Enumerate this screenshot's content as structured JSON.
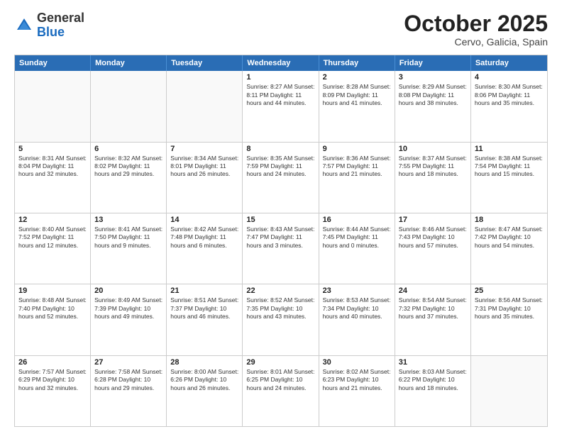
{
  "logo": {
    "general": "General",
    "blue": "Blue"
  },
  "header": {
    "month": "October 2025",
    "location": "Cervo, Galicia, Spain"
  },
  "days": [
    "Sunday",
    "Monday",
    "Tuesday",
    "Wednesday",
    "Thursday",
    "Friday",
    "Saturday"
  ],
  "weeks": [
    [
      {
        "day": "",
        "content": ""
      },
      {
        "day": "",
        "content": ""
      },
      {
        "day": "",
        "content": ""
      },
      {
        "day": "1",
        "content": "Sunrise: 8:27 AM\nSunset: 8:11 PM\nDaylight: 11 hours and 44 minutes."
      },
      {
        "day": "2",
        "content": "Sunrise: 8:28 AM\nSunset: 8:09 PM\nDaylight: 11 hours and 41 minutes."
      },
      {
        "day": "3",
        "content": "Sunrise: 8:29 AM\nSunset: 8:08 PM\nDaylight: 11 hours and 38 minutes."
      },
      {
        "day": "4",
        "content": "Sunrise: 8:30 AM\nSunset: 8:06 PM\nDaylight: 11 hours and 35 minutes."
      }
    ],
    [
      {
        "day": "5",
        "content": "Sunrise: 8:31 AM\nSunset: 8:04 PM\nDaylight: 11 hours and 32 minutes."
      },
      {
        "day": "6",
        "content": "Sunrise: 8:32 AM\nSunset: 8:02 PM\nDaylight: 11 hours and 29 minutes."
      },
      {
        "day": "7",
        "content": "Sunrise: 8:34 AM\nSunset: 8:01 PM\nDaylight: 11 hours and 26 minutes."
      },
      {
        "day": "8",
        "content": "Sunrise: 8:35 AM\nSunset: 7:59 PM\nDaylight: 11 hours and 24 minutes."
      },
      {
        "day": "9",
        "content": "Sunrise: 8:36 AM\nSunset: 7:57 PM\nDaylight: 11 hours and 21 minutes."
      },
      {
        "day": "10",
        "content": "Sunrise: 8:37 AM\nSunset: 7:55 PM\nDaylight: 11 hours and 18 minutes."
      },
      {
        "day": "11",
        "content": "Sunrise: 8:38 AM\nSunset: 7:54 PM\nDaylight: 11 hours and 15 minutes."
      }
    ],
    [
      {
        "day": "12",
        "content": "Sunrise: 8:40 AM\nSunset: 7:52 PM\nDaylight: 11 hours and 12 minutes."
      },
      {
        "day": "13",
        "content": "Sunrise: 8:41 AM\nSunset: 7:50 PM\nDaylight: 11 hours and 9 minutes."
      },
      {
        "day": "14",
        "content": "Sunrise: 8:42 AM\nSunset: 7:48 PM\nDaylight: 11 hours and 6 minutes."
      },
      {
        "day": "15",
        "content": "Sunrise: 8:43 AM\nSunset: 7:47 PM\nDaylight: 11 hours and 3 minutes."
      },
      {
        "day": "16",
        "content": "Sunrise: 8:44 AM\nSunset: 7:45 PM\nDaylight: 11 hours and 0 minutes."
      },
      {
        "day": "17",
        "content": "Sunrise: 8:46 AM\nSunset: 7:43 PM\nDaylight: 10 hours and 57 minutes."
      },
      {
        "day": "18",
        "content": "Sunrise: 8:47 AM\nSunset: 7:42 PM\nDaylight: 10 hours and 54 minutes."
      }
    ],
    [
      {
        "day": "19",
        "content": "Sunrise: 8:48 AM\nSunset: 7:40 PM\nDaylight: 10 hours and 52 minutes."
      },
      {
        "day": "20",
        "content": "Sunrise: 8:49 AM\nSunset: 7:39 PM\nDaylight: 10 hours and 49 minutes."
      },
      {
        "day": "21",
        "content": "Sunrise: 8:51 AM\nSunset: 7:37 PM\nDaylight: 10 hours and 46 minutes."
      },
      {
        "day": "22",
        "content": "Sunrise: 8:52 AM\nSunset: 7:35 PM\nDaylight: 10 hours and 43 minutes."
      },
      {
        "day": "23",
        "content": "Sunrise: 8:53 AM\nSunset: 7:34 PM\nDaylight: 10 hours and 40 minutes."
      },
      {
        "day": "24",
        "content": "Sunrise: 8:54 AM\nSunset: 7:32 PM\nDaylight: 10 hours and 37 minutes."
      },
      {
        "day": "25",
        "content": "Sunrise: 8:56 AM\nSunset: 7:31 PM\nDaylight: 10 hours and 35 minutes."
      }
    ],
    [
      {
        "day": "26",
        "content": "Sunrise: 7:57 AM\nSunset: 6:29 PM\nDaylight: 10 hours and 32 minutes."
      },
      {
        "day": "27",
        "content": "Sunrise: 7:58 AM\nSunset: 6:28 PM\nDaylight: 10 hours and 29 minutes."
      },
      {
        "day": "28",
        "content": "Sunrise: 8:00 AM\nSunset: 6:26 PM\nDaylight: 10 hours and 26 minutes."
      },
      {
        "day": "29",
        "content": "Sunrise: 8:01 AM\nSunset: 6:25 PM\nDaylight: 10 hours and 24 minutes."
      },
      {
        "day": "30",
        "content": "Sunrise: 8:02 AM\nSunset: 6:23 PM\nDaylight: 10 hours and 21 minutes."
      },
      {
        "day": "31",
        "content": "Sunrise: 8:03 AM\nSunset: 6:22 PM\nDaylight: 10 hours and 18 minutes."
      },
      {
        "day": "",
        "content": ""
      }
    ]
  ]
}
